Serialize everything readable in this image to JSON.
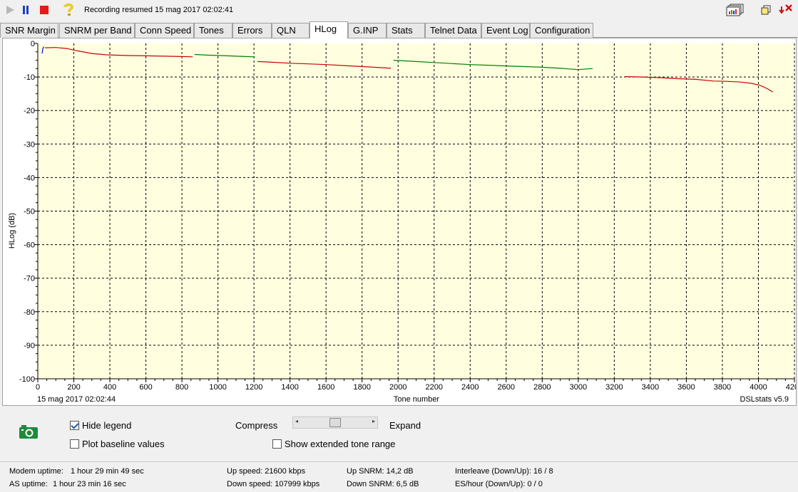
{
  "toolbar": {
    "play_icon": "play-icon",
    "pause_icon": "pause-icon",
    "stop_icon": "stop-icon",
    "help_icon": "question-icon",
    "status": "Recording resumed 15 mag 2017 02:02:41",
    "right_icons": [
      "chart-windows-icon",
      "restore-window-icon",
      "close-download-icon"
    ]
  },
  "tabs": [
    {
      "label": "SNR Margin"
    },
    {
      "label": "SNRM per Band"
    },
    {
      "label": "Conn Speed"
    },
    {
      "label": "Tones"
    },
    {
      "label": "Errors"
    },
    {
      "label": "QLN"
    },
    {
      "label": "HLog",
      "active": true
    },
    {
      "label": "G.INP"
    },
    {
      "label": "Stats"
    },
    {
      "label": "Telnet Data"
    },
    {
      "label": "Event Log"
    },
    {
      "label": "Configuration"
    }
  ],
  "chart": {
    "timestamp": "15 mag 2017 02:02:44",
    "version": "DSLstats v5.9",
    "background": "#ffffe0",
    "grid": true
  },
  "chart_data": {
    "type": "line",
    "xlabel": "Tone number",
    "ylabel": "HLog (dB)",
    "xlim": [
      0,
      4200
    ],
    "ylim": [
      -100,
      0
    ],
    "xticks": [
      0,
      200,
      400,
      600,
      800,
      1000,
      1200,
      1400,
      1600,
      1800,
      2000,
      2200,
      2400,
      2600,
      2800,
      3000,
      3200,
      3400,
      3600,
      3800,
      4000,
      4200
    ],
    "yticks": [
      0,
      -10,
      -20,
      -30,
      -40,
      -50,
      -60,
      -70,
      -80,
      -90,
      -100
    ],
    "series": [
      {
        "color": "#0000cc",
        "points": [
          [
            24,
            -3
          ],
          [
            28,
            -1.5
          ],
          [
            34,
            -1
          ]
        ]
      },
      {
        "color": "#cc0000",
        "points": [
          [
            40,
            -1.3
          ],
          [
            100,
            -1.2
          ],
          [
            160,
            -1.5
          ],
          [
            220,
            -2.2
          ],
          [
            300,
            -3.0
          ],
          [
            380,
            -3.4
          ],
          [
            500,
            -3.6
          ],
          [
            600,
            -3.7
          ],
          [
            700,
            -3.8
          ],
          [
            800,
            -3.9
          ],
          [
            860,
            -4.0
          ]
        ]
      },
      {
        "color": "#008000",
        "points": [
          [
            870,
            -3.3
          ],
          [
            950,
            -3.5
          ],
          [
            1050,
            -3.7
          ],
          [
            1150,
            -3.9
          ],
          [
            1205,
            -4.0
          ]
        ]
      },
      {
        "color": "#cc0000",
        "points": [
          [
            1220,
            -5.4
          ],
          [
            1300,
            -5.6
          ],
          [
            1400,
            -5.9
          ],
          [
            1500,
            -6.1
          ],
          [
            1600,
            -6.3
          ],
          [
            1700,
            -6.6
          ],
          [
            1800,
            -6.9
          ],
          [
            1900,
            -7.2
          ],
          [
            1960,
            -7.4
          ]
        ]
      },
      {
        "color": "#008000",
        "points": [
          [
            1975,
            -5.0
          ],
          [
            2100,
            -5.4
          ],
          [
            2200,
            -5.7
          ],
          [
            2300,
            -6.0
          ],
          [
            2400,
            -6.3
          ],
          [
            2500,
            -6.5
          ],
          [
            2600,
            -6.7
          ],
          [
            2700,
            -6.9
          ],
          [
            2800,
            -7.1
          ],
          [
            2900,
            -7.4
          ],
          [
            2950,
            -7.6
          ],
          [
            3000,
            -7.8
          ],
          [
            3080,
            -7.5
          ]
        ]
      },
      {
        "color": "#cc0000",
        "points": [
          [
            3260,
            -9.9
          ],
          [
            3350,
            -10.0
          ],
          [
            3450,
            -10.2
          ],
          [
            3550,
            -10.5
          ],
          [
            3650,
            -10.7
          ],
          [
            3750,
            -11.2
          ],
          [
            3820,
            -11.3
          ],
          [
            3900,
            -11.5
          ],
          [
            3960,
            -11.9
          ],
          [
            4010,
            -12.5
          ],
          [
            4050,
            -13.5
          ],
          [
            4080,
            -14.5
          ]
        ]
      }
    ]
  },
  "controls": {
    "camera_icon": "camera-icon",
    "hide_legend": {
      "label": "Hide legend",
      "checked": true
    },
    "plot_baseline": {
      "label": "Plot baseline values",
      "checked": false
    },
    "compress_label": "Compress",
    "expand_label": "Expand",
    "zoom_level": 0.5,
    "extended_range": {
      "label": "Show extended tone range",
      "checked": false
    }
  },
  "status_bar": {
    "modem_uptime_label": "Modem uptime:",
    "modem_uptime": "1 hour 29 min 49 sec",
    "as_uptime_label": "AS uptime:",
    "as_uptime": "1 hour 23 min 16 sec",
    "up_speed": "Up speed: 21600 kbps",
    "down_speed": "Down speed: 107999 kbps",
    "up_snrm": "Up SNRM: 14,2 dB",
    "down_snrm": "Down SNRM: 6,5 dB",
    "interleave": "Interleave (Down/Up): 16 / 8",
    "es_hour": "ES/hour (Down/Up): 0 / 0"
  }
}
